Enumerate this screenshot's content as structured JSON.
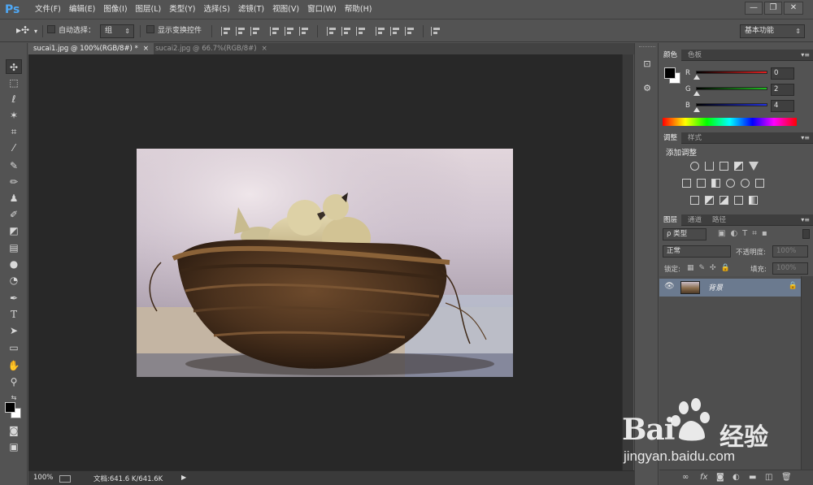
{
  "app": {
    "logo": "Ps"
  },
  "menu": [
    "文件(F)",
    "编辑(E)",
    "图像(I)",
    "图层(L)",
    "类型(Y)",
    "选择(S)",
    "滤镜(T)",
    "视图(V)",
    "窗口(W)",
    "帮助(H)"
  ],
  "window_controls": {
    "minimize": "—",
    "restore": "❐",
    "close": "✕"
  },
  "options": {
    "move_tool_icon": "move-tool-icon",
    "auto_select_label": "自动选择：",
    "auto_select_value": "组",
    "show_transform_label": "显示变换控件",
    "workspace": "基本功能"
  },
  "tabs": [
    {
      "label": "sucai1.jpg @ 100%(RGB/8#) *",
      "close": "×"
    },
    {
      "label": "sucai2.jpg @ 66.7%(RGB/8#)",
      "close": "×"
    }
  ],
  "status": {
    "zoom": "100%",
    "doc": "文档:641.6 K/641.6K",
    "arrow": "▶"
  },
  "color_panel": {
    "tabs": [
      "颜色",
      "色板"
    ],
    "r_label": "R",
    "g_label": "G",
    "b_label": "B",
    "r": "0",
    "g": "2",
    "b": "4",
    "r_color": "#e02020",
    "g_color": "#20c020",
    "b_color": "#2030e0"
  },
  "adjust_panel": {
    "tabs": [
      "调整",
      "样式"
    ],
    "title": "添加调整"
  },
  "layers_panel": {
    "tabs": [
      "图层",
      "通道",
      "路径"
    ],
    "filter_kind": "ρ 类型",
    "blend_mode": "正常",
    "opacity_label": "不透明度:",
    "opacity_value": "100%",
    "lock_label": "锁定:",
    "fill_label": "填充:",
    "fill_value": "100%",
    "layer_name": "背景"
  },
  "watermark": {
    "brand": "Bai",
    "cn": "经验",
    "url": "jingyan.baidu.com"
  }
}
